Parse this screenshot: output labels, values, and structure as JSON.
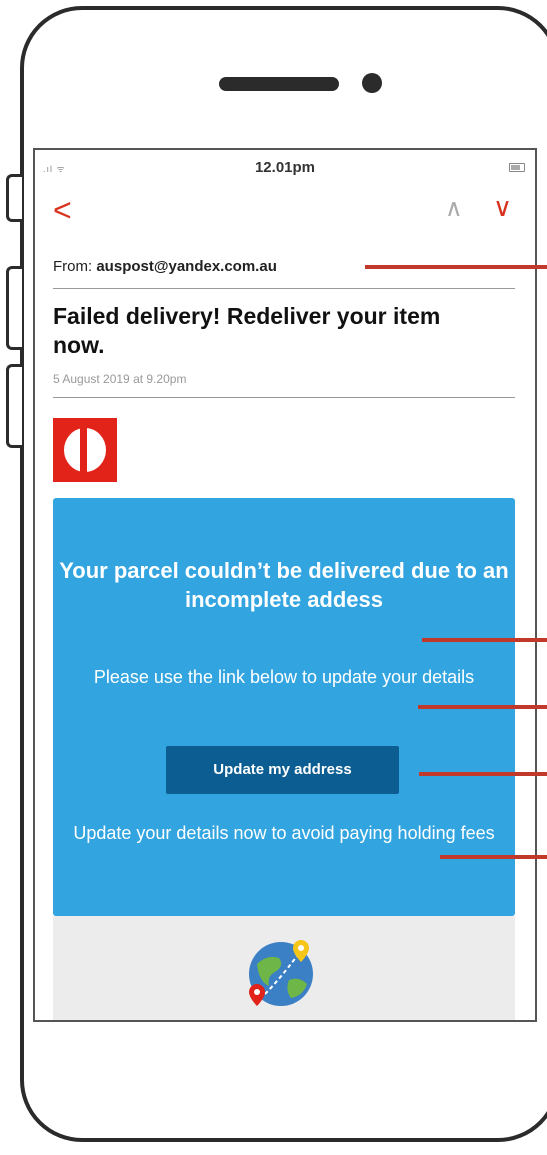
{
  "status_bar": {
    "time": "12.01pm"
  },
  "email": {
    "from_label": "From: ",
    "from_address": "auspost@yandex.com.au",
    "subject": "Failed delivery! Redeliver your item now.",
    "date": "5 August 2019 at 9.20pm"
  },
  "banner": {
    "heading": "Your parcel couldn’t be delivered due to an incomplete addess",
    "subheading": "Please use the link below to update your details",
    "button_label": "Update my address",
    "note": "Update your details now to avoid paying holding fees"
  },
  "colors": {
    "brand_red": "#e2231a",
    "banner_blue": "#32a4e0",
    "button_blue": "#0b5d92",
    "annotation_red": "#c0392b"
  }
}
